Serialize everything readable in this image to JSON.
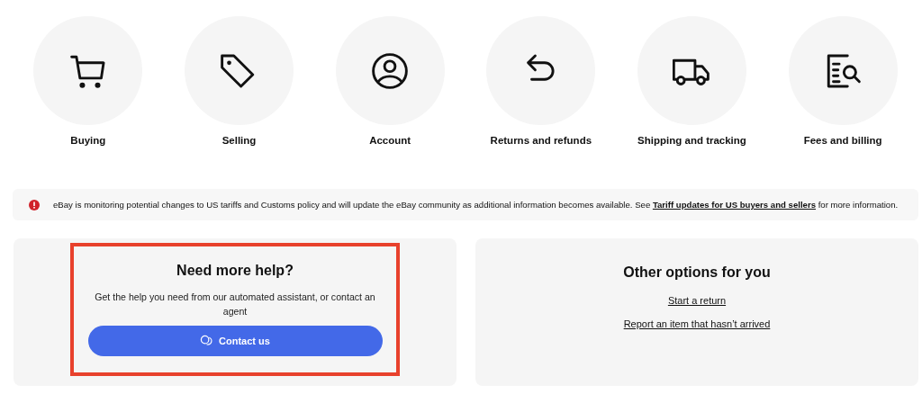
{
  "topics": [
    {
      "label": "Buying"
    },
    {
      "label": "Selling"
    },
    {
      "label": "Account"
    },
    {
      "label": "Returns and refunds"
    },
    {
      "label": "Shipping and tracking"
    },
    {
      "label": "Fees and billing"
    }
  ],
  "alert": {
    "text_before": "eBay is monitoring potential changes to US tariffs and Customs policy and will update the eBay community as additional information becomes available. See ",
    "link": "Tariff updates for US buyers and sellers",
    "text_after": " for more information."
  },
  "help_card": {
    "title": "Need more help?",
    "text": "Get the help you need from our automated assistant, or contact an agent",
    "button": "Contact us",
    "highlighted": true
  },
  "options_card": {
    "title": "Other options for you",
    "links": [
      "Start a return",
      "Report an item that hasn’t arrived"
    ]
  }
}
